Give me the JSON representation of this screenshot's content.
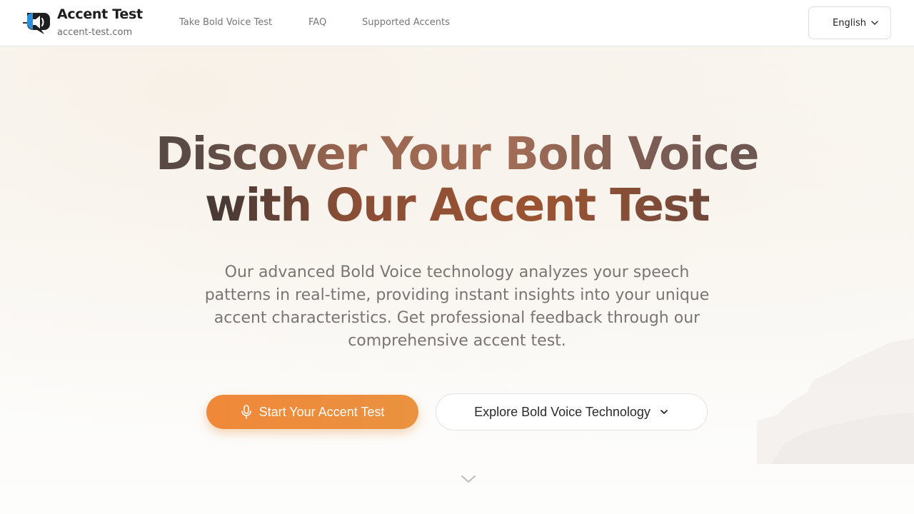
{
  "header": {
    "brand_title": "Accent Test",
    "brand_domain": "accent-test.com",
    "nav": [
      {
        "label": "Take Bold Voice Test"
      },
      {
        "label": "FAQ"
      },
      {
        "label": "Supported Accents"
      }
    ],
    "language": "English"
  },
  "hero": {
    "title_line1": "Discover Your Bold Voice",
    "title_line2": "with Our Accent Test",
    "subtitle": "Our advanced Bold Voice technology analyzes your speech patterns in real-time, providing instant insights into your unique accent characteristics. Get professional feedback through our comprehensive accent test.",
    "primary_button": "Start Your Accent Test",
    "secondary_button": "Explore Bold Voice Technology"
  },
  "icons": {
    "logo": "speaker-chat-icon",
    "language_chevron": "chevron-down-icon",
    "primary_button_icon": "microphone-icon",
    "secondary_button_icon": "chevron-down-icon",
    "scroll_indicator": "chevron-down-icon"
  },
  "colors": {
    "accent_orange": "#f0883a",
    "title_brown": "#9b5432",
    "text_gray": "#7a7473",
    "logo_blue": "#2b8fe0"
  }
}
